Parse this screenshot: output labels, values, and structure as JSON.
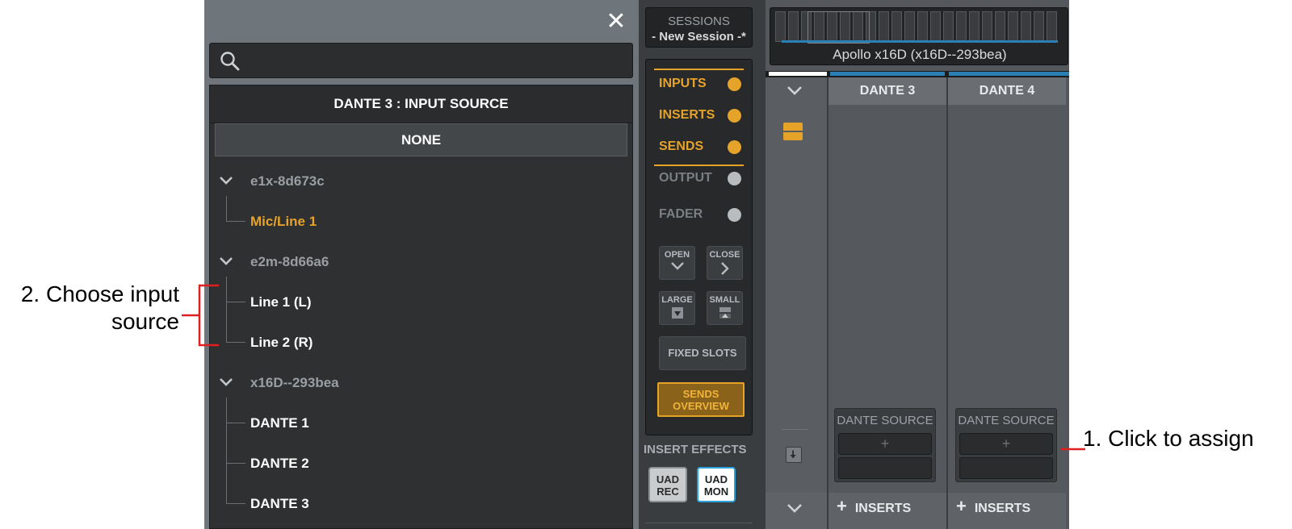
{
  "panel": {
    "close_glyph": "✕",
    "search": {
      "value": "",
      "icon": "search-icon"
    },
    "title": "DANTE 3 : INPUT SOURCE",
    "none_label": "NONE",
    "groups": [
      {
        "label": "e1x-8d673c",
        "items": [
          {
            "label": "Mic/Line 1",
            "active": true
          }
        ]
      },
      {
        "label": "e2m-8d66a6",
        "items": [
          {
            "label": "Line 1 (L)"
          },
          {
            "label": "Line 2 (R)"
          }
        ]
      },
      {
        "label": "x16D--293bea",
        "items": [
          {
            "label": "DANTE 1"
          },
          {
            "label": "DANTE 2"
          },
          {
            "label": "DANTE 3"
          }
        ]
      }
    ]
  },
  "sidebar": {
    "sessions_title": "SESSIONS",
    "session_name": "- New Session -*",
    "view_rows": [
      {
        "label": "INPUTS",
        "state": "on"
      },
      {
        "label": "INSERTS",
        "state": "on"
      },
      {
        "label": "SENDS",
        "state": "on"
      },
      {
        "label": "OUTPUT",
        "state": "off"
      },
      {
        "label": "FADER",
        "state": "off"
      }
    ],
    "open_label": "OPEN",
    "close_label": "CLOSE",
    "large_label": "LARGE",
    "small_label": "SMALL",
    "fixed_slots": "FIXED SLOTS",
    "sends_overview_1": "SENDS",
    "sends_overview_2": "OVERVIEW",
    "insert_effects_title": "INSERT EFFECTS",
    "uad_rec_1": "UAD",
    "uad_rec_2": "REC",
    "uad_mon_1": "UAD",
    "uad_mon_2": "MON"
  },
  "mixer": {
    "device_name": "Apollo x16D (x16D--293bea)",
    "channels": [
      {
        "name": "DANTE 3",
        "source_label": "DANTE SOURCE",
        "add_glyph": "+",
        "inserts_label": "INSERTS",
        "inserts_glyph": "+"
      },
      {
        "name": "DANTE 4",
        "source_label": "DANTE SOURCE",
        "add_glyph": "+",
        "inserts_label": "INSERTS",
        "inserts_glyph": "+"
      }
    ]
  },
  "annotations": {
    "step2_line1": "2. Choose input",
    "step2_line2": "source",
    "step1": "1. Click to assign"
  },
  "colors": {
    "accent_orange": "#e6a329",
    "annotation_red": "#e02020",
    "selection_blue": "#2a7fb4",
    "uad_mon_border": "#2aa1d9"
  }
}
